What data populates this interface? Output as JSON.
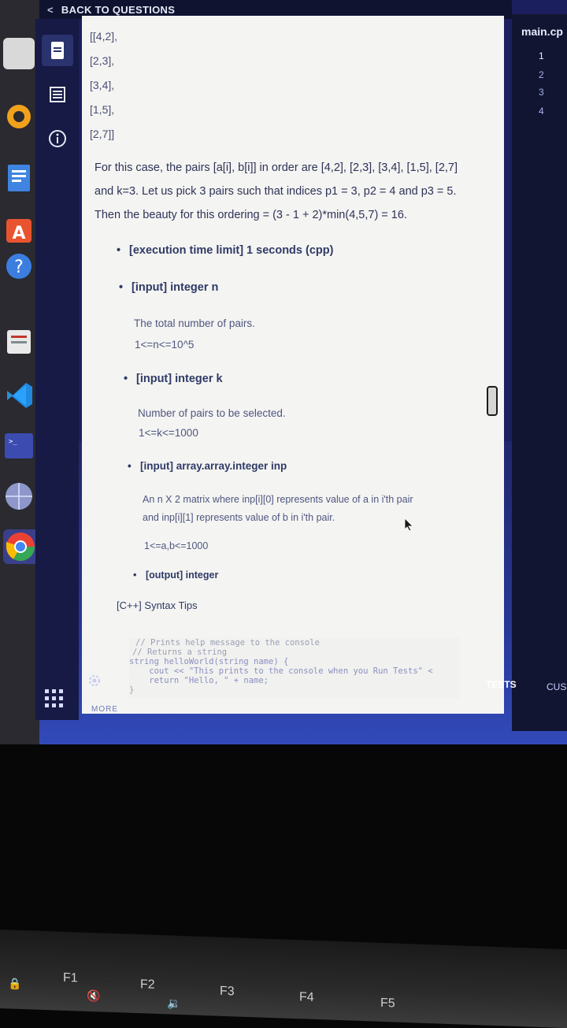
{
  "header": {
    "back_label": "BACK TO QUESTIONS"
  },
  "code_lines": [
    "[[4,2],",
    "[2,3],",
    "[3,4],",
    "[1,5],",
    "[2,7]]"
  ],
  "explanation": [
    "For this case, the pairs [a[i], b[i]] in order are [4,2], [2,3], [3,4], [1,5], [2,7]",
    "and k=3. Let us pick 3 pairs such that indices p1 = 3, p2 = 4 and p3 = 5.",
    "Then the beauty for this ordering = (3 - 1 + 2)*min(4,5,7) = 16."
  ],
  "limits": {
    "execution_time": "[execution time limit] 1 seconds (cpp)"
  },
  "inputs": [
    {
      "label": "[input] integer n",
      "desc": [
        "The total number of pairs.",
        "1<=n<=10^5"
      ]
    },
    {
      "label": "[input] integer k",
      "desc": [
        "Number of pairs to be selected.",
        "1<=k<=1000"
      ]
    },
    {
      "label": "[input] array.array.integer inp",
      "desc": [
        "An n X 2 matrix where inp[i][0] represents value of a in i'th pair",
        "and inp[i][1] represents value of b in i'th pair.",
        "1<=a,b<=1000"
      ]
    }
  ],
  "output": {
    "label": "[output] integer"
  },
  "syntax_tips": {
    "title": "[C++] Syntax Tips",
    "code": [
      "// Prints help message to the console",
      "// Returns a string",
      "string helloWorld(string name) {",
      "    cout << \"This prints to the console when you Run Tests\" <",
      "    return \"Hello, \" + name;",
      "}"
    ]
  },
  "footer": {
    "more_label": "MORE",
    "tests_label": "TESTS",
    "custom_label": "CUS"
  },
  "editor": {
    "tab": "main.cp",
    "line_numbers": [
      "1",
      "2",
      "3",
      "4"
    ]
  },
  "keyboard": {
    "keys": [
      "F1",
      "F2",
      "F3",
      "F4",
      "F5"
    ]
  }
}
